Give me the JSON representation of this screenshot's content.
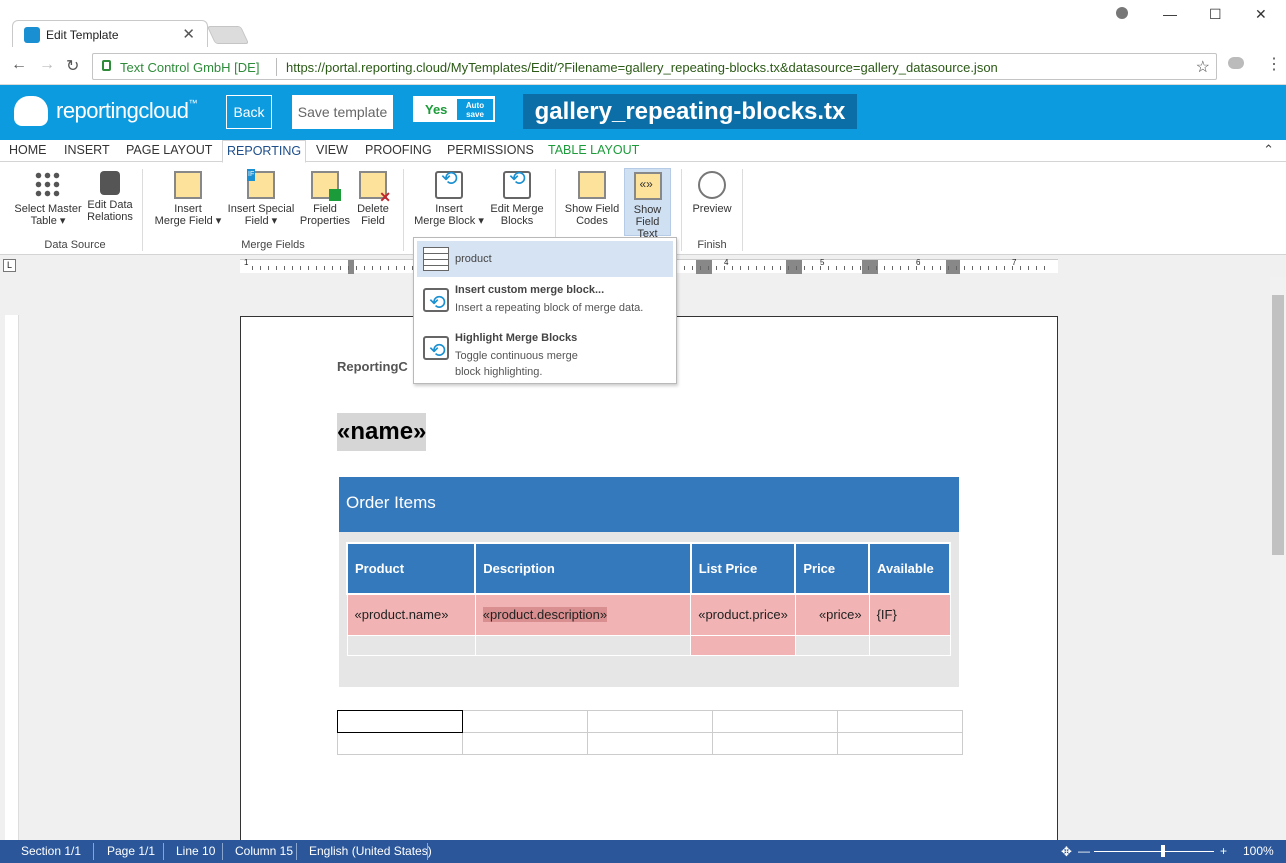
{
  "browser": {
    "tab_title": "Edit Template",
    "tab_close": "✕",
    "org": "Text Control GmbH [DE]",
    "url": "https://portal.reporting.cloud/MyTemplates/Edit/?Filename=gallery_repeating-blocks.tx&datasource=gallery_datasource.json",
    "win_minimize": "—",
    "win_maximize": "☐",
    "win_close": "✕",
    "back_arrow": "←",
    "forward_arrow": "→",
    "reload": "↻",
    "star": "☆"
  },
  "app": {
    "logo_text": "reportingcloud",
    "logo_tm": "™",
    "back_label": "Back",
    "save_label": "Save template",
    "autosave_value": "Yes",
    "autosave_label_1": "Auto",
    "autosave_label_2": "save",
    "filename": "gallery_repeating-blocks.tx"
  },
  "ribbon_tabs": [
    {
      "label": "HOME"
    },
    {
      "label": "INSERT"
    },
    {
      "label": "PAGE LAYOUT"
    },
    {
      "label": "REPORTING",
      "active": true
    },
    {
      "label": "VIEW"
    },
    {
      "label": "PROOFING"
    },
    {
      "label": "PERMISSIONS"
    },
    {
      "label": "TABLE LAYOUT",
      "contextual": true
    }
  ],
  "ribbon": {
    "select_master_1": "Select Master",
    "select_master_2": "Table ▾",
    "edit_relations_1": "Edit Data",
    "edit_relations_2": "Relations",
    "group_data_source": "Data Source",
    "insert_merge_field_1": "Insert",
    "insert_merge_field_2": "Merge Field ▾",
    "insert_special_1": "Insert Special",
    "insert_special_2": "Field ▾",
    "field_props_1": "Field",
    "field_props_2": "Properties",
    "delete_field_1": "Delete",
    "delete_field_2": "Field",
    "group_merge_fields": "Merge Fields",
    "insert_block_1": "Insert",
    "insert_block_2": "Merge Block ▾",
    "edit_blocks_1": "Edit Merge",
    "edit_blocks_2": "Blocks",
    "show_codes_1": "Show Field",
    "show_codes_2": "Codes",
    "show_text_1": "Show",
    "show_text_2": "Field Text",
    "preview": "Preview",
    "group_finish": "Finish",
    "if_badge": "IF",
    "collapse": "⌃"
  },
  "ruler": {
    "marks": [
      "1",
      "4",
      "5",
      "6",
      "7"
    ],
    "corner": "L"
  },
  "dropdown": {
    "item1": "product",
    "item2_title": "Insert custom merge block...",
    "item2_desc": "Insert a repeating block of merge data.",
    "item3_title": "Highlight Merge Blocks",
    "item3_desc": "Toggle continuous merge block highlighting."
  },
  "document": {
    "header_text": "ReportingC",
    "name_field": "«name»",
    "order_title": "Order Items",
    "columns": [
      "Product",
      "Description",
      "List Price",
      "Price",
      "Available"
    ],
    "row": [
      "«product.name»",
      "«product.description»",
      "«product.price»",
      "«price»",
      "{IF}"
    ]
  },
  "status": {
    "section": "Section 1/1",
    "page": "Page 1/1",
    "line": "Line 10",
    "column": "Column 15",
    "language": "English (United States)",
    "zoom": "100%",
    "zoom_minus": "—",
    "zoom_plus": "+"
  }
}
